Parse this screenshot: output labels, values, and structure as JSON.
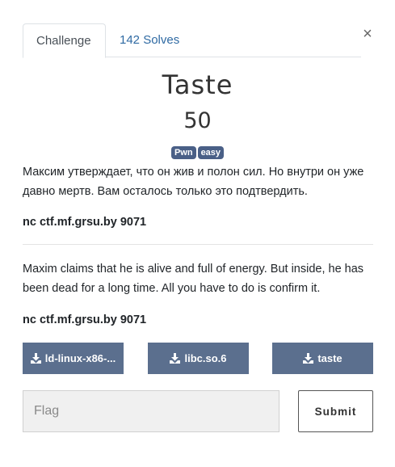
{
  "tabs": {
    "challenge": "Challenge",
    "solves": "142 Solves"
  },
  "close_symbol": "×",
  "challenge": {
    "name": "Taste",
    "value": "50",
    "tags": [
      "Pwn",
      "easy"
    ],
    "description_ru": "Максим утверждает, что он жив и полон сил. Но внутри он уже давно мертв. Вам осталось только это подтвердить.",
    "connection_ru": "nc ctf.mf.grsu.by 9071",
    "description_en": "Maxim claims that he is alive and full of energy. But inside, he has been dead for a long time. All you have to do is confirm it.",
    "connection_en": "nc ctf.mf.grsu.by 9071"
  },
  "files": [
    {
      "label": "ld-linux-x86-...",
      "icon": "download-icon"
    },
    {
      "label": "libc.so.6",
      "icon": "download-icon"
    },
    {
      "label": "taste",
      "icon": "download-icon"
    }
  ],
  "flag_form": {
    "placeholder": "Flag",
    "value": "",
    "submit_label": "Submit"
  },
  "colors": {
    "tab_link": "#2f6aa3",
    "tag_bg": "#4a6087",
    "file_button_bg": "#5b6f8e"
  }
}
